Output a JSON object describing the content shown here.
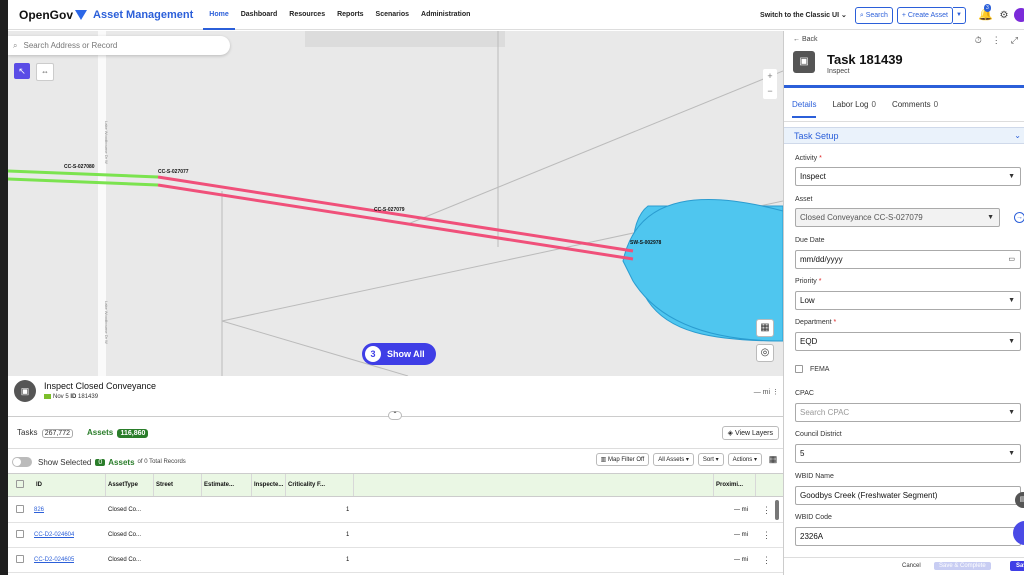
{
  "nav": {
    "brand": "OpenGov",
    "app_name": "Asset Management",
    "links": [
      "Home",
      "Dashboard",
      "Resources",
      "Reports",
      "Scenarios",
      "Administration"
    ],
    "active": "Home",
    "switch_label": "Switch to the Classic UI",
    "search_label": "Search",
    "create_label": "+ Create Asset",
    "notif_count": "3"
  },
  "map": {
    "search_placeholder": "Search Address or Record",
    "show_all_count": "3",
    "show_all_label": "Show All",
    "street_labels": [
      "Lake Woodbourne Dr W",
      "Lake Woodbourne Dr W"
    ],
    "asset_labels": [
      "CC-S-027080",
      "CC-S-027077",
      "CC-S-027079",
      "SW-S-002978"
    ],
    "colors": {
      "pink": "#f0507a",
      "green": "#7be34f",
      "water": "#4fc6ef"
    }
  },
  "bottom": {
    "inspect_title": "Inspect Closed Conveyance",
    "inspect_date": "Nov 5",
    "inspect_id_label": "ID",
    "inspect_id": "181439",
    "distance": "— mi",
    "tabs": {
      "tasks_label": "Tasks",
      "tasks_count": "267,772",
      "assets_label": "Assets",
      "assets_count": "116,860"
    },
    "view_layers": "View Layers",
    "show_selected": "Show Selected",
    "selected_count": "0",
    "assets_word": "Assets",
    "of_total": "of 0 Total Records",
    "map_filter": "Map Filter Off",
    "all_assets": "All Assets",
    "sort": "Sort",
    "actions": "Actions",
    "columns": [
      "ID",
      "AssetType",
      "Street",
      "Estimate...",
      "Inspecte...",
      "Criticality F...",
      "Proximi..."
    ],
    "rows": [
      {
        "id": "826",
        "type": "Closed Co...",
        "crit": "1",
        "prox": "— mi"
      },
      {
        "id": "CC-D2-024604",
        "type": "Closed Co...",
        "crit": "1",
        "prox": "— mi"
      },
      {
        "id": "CC-D2-024605",
        "type": "Closed Co...",
        "crit": "1",
        "prox": "— mi"
      }
    ]
  },
  "side": {
    "back": "Back",
    "task_title": "Task 181439",
    "task_sub": "Inspect",
    "tabs": {
      "details": "Details",
      "labor_log": "Labor Log",
      "labor_count": "0",
      "comments": "Comments",
      "comments_count": "0"
    },
    "section": "Task Setup",
    "fields": {
      "activity_label": "Activity",
      "activity_value": "Inspect",
      "asset_label": "Asset",
      "asset_value": "Closed Conveyance CC-S-027079",
      "due_label": "Due Date",
      "due_value": "mm/dd/yyyy",
      "priority_label": "Priority",
      "priority_value": "Low",
      "dept_label": "Department",
      "dept_value": "EQD",
      "fema_label": "FEMA",
      "cpac_label": "CPAC",
      "cpac_placeholder": "Search CPAC",
      "council_label": "Council District",
      "council_value": "5",
      "wbid_name_label": "WBID Name",
      "wbid_name_value": "Goodbys Creek (Freshwater Segment)",
      "wbid_code_label": "WBID Code",
      "wbid_code_value": "2326A"
    },
    "footer": {
      "cancel": "Cancel",
      "save_complete": "Save & Complete",
      "save": "Save"
    }
  }
}
